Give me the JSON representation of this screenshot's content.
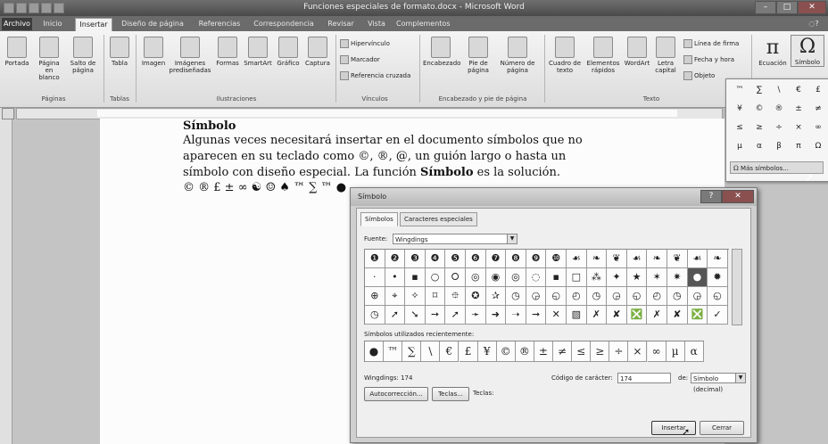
{
  "window": {
    "title": "Funciones especiales de formato.docx - Microsoft Word",
    "min": "–",
    "max": "□",
    "close": "✕"
  },
  "tabs": [
    "Archivo",
    "Inicio",
    "Insertar",
    "Diseño de página",
    "Referencias",
    "Correspondencia",
    "Revisar",
    "Vista",
    "Complementos"
  ],
  "ribbon": {
    "paginas": {
      "portada": "Portada",
      "pagina_blanco": "Página en blanco",
      "salto": "Salto de página",
      "label": "Páginas"
    },
    "tablas": {
      "tabla": "Tabla",
      "label": "Tablas"
    },
    "ilustraciones": {
      "imagen": "Imagen",
      "predisenadas": "Imágenes prediseñadas",
      "formas": "Formas",
      "smartart": "SmartArt",
      "grafico": "Gráfico",
      "captura": "Captura",
      "label": "Ilustraciones"
    },
    "vinculos": {
      "hipervinculo": "Hipervínculo",
      "marcador": "Marcador",
      "referencia": "Referencia cruzada",
      "label": "Vínculos"
    },
    "encabezado": {
      "encabezado": "Encabezado",
      "pie": "Pie de página",
      "numero": "Número de página",
      "label": "Encabezado y pie de página"
    },
    "texto": {
      "cuadro": "Cuadro de texto",
      "elementos": "Elementos rápidos",
      "wordart": "WordArt",
      "letra": "Letra capital",
      "firma": "Línea de firma",
      "fecha": "Fecha y hora",
      "objeto": "Objeto",
      "label": "Texto"
    },
    "simbolos": {
      "ecuacion": "Ecuación",
      "simbolo": "Símbolo",
      "pi_glyph": "π",
      "omega_glyph": "Ω"
    }
  },
  "document": {
    "heading": "Símbolo",
    "line1": "Algunas veces necesitará insertar en el documento símbolos que no",
    "line2": "aparecen en su teclado como ©, ®, @, un guión largo o hasta un",
    "line3_start": "símbolo con diseño especial. La función ",
    "line3_bold": "Símbolo",
    "line3_end": " es la solución.",
    "symbols_line": "© ® £ ± ∞ ☯ ☺ ♠ ™ ∑ ™ ●"
  },
  "symbol_dropdown": {
    "grid": [
      "™",
      "∑",
      "\\",
      "€",
      "£",
      "¥",
      "©",
      "®",
      "±",
      "≠",
      "≤",
      "≥",
      "÷",
      "×",
      "∞",
      "µ",
      "α",
      "β",
      "π",
      "Ω"
    ],
    "more": "Más símbolos..."
  },
  "dialog": {
    "title": "Símbolo",
    "help": "?",
    "close": "✕",
    "tab_simbolos": "Símbolos",
    "tab_especiales": "Caracteres especiales",
    "fuente_label": "Fuente:",
    "fuente_value": "Wingdings",
    "grid": [
      [
        "❶",
        "❷",
        "❸",
        "❹",
        "❺",
        "❻",
        "❼",
        "❽",
        "❾",
        "❿",
        "☙",
        "❧",
        "❦",
        "☙",
        "❧",
        "❦",
        "☙",
        "❧"
      ],
      [
        "·",
        "•",
        "▪",
        "○",
        "⭘",
        "◎",
        "◉",
        "◎",
        "◌",
        "▪",
        "□",
        "⁂",
        "✦",
        "★",
        "✶",
        "✷",
        "●",
        "✹"
      ],
      [
        "⊕",
        "⌖",
        "✧",
        "⌑",
        "⯐",
        "✪",
        "✰",
        "◷",
        "◶",
        "◵",
        "◴",
        "◷",
        "◶",
        "◵",
        "◴",
        "◷",
        "◶",
        "◵"
      ],
      [
        "◷",
        "➚",
        "➘",
        "➙",
        "➚",
        "➛",
        "➜",
        "➝",
        "➞",
        "✕",
        "▧",
        "✗",
        "✘",
        "❎",
        "✗",
        "✘",
        "❎",
        "✓"
      ]
    ],
    "recent_label": "Símbolos utilizados recientemente:",
    "recent": [
      "●",
      "™",
      "∑",
      "\\",
      "€",
      "£",
      "¥",
      "©",
      "®",
      "±",
      "≠",
      "≤",
      "≥",
      "÷",
      "×",
      "∞",
      "µ",
      "α"
    ],
    "font_info": "Wingdings: 174",
    "codigo_label": "Código de carácter:",
    "codigo_value": "174",
    "de_label": "de:",
    "de_value": "Símbolo (decimal)",
    "autocorreccion": "Autocorrección...",
    "teclas_btn": "Teclas...",
    "teclas_label": "Teclas:",
    "insertar": "Insertar",
    "cerrar": "Cerrar"
  }
}
